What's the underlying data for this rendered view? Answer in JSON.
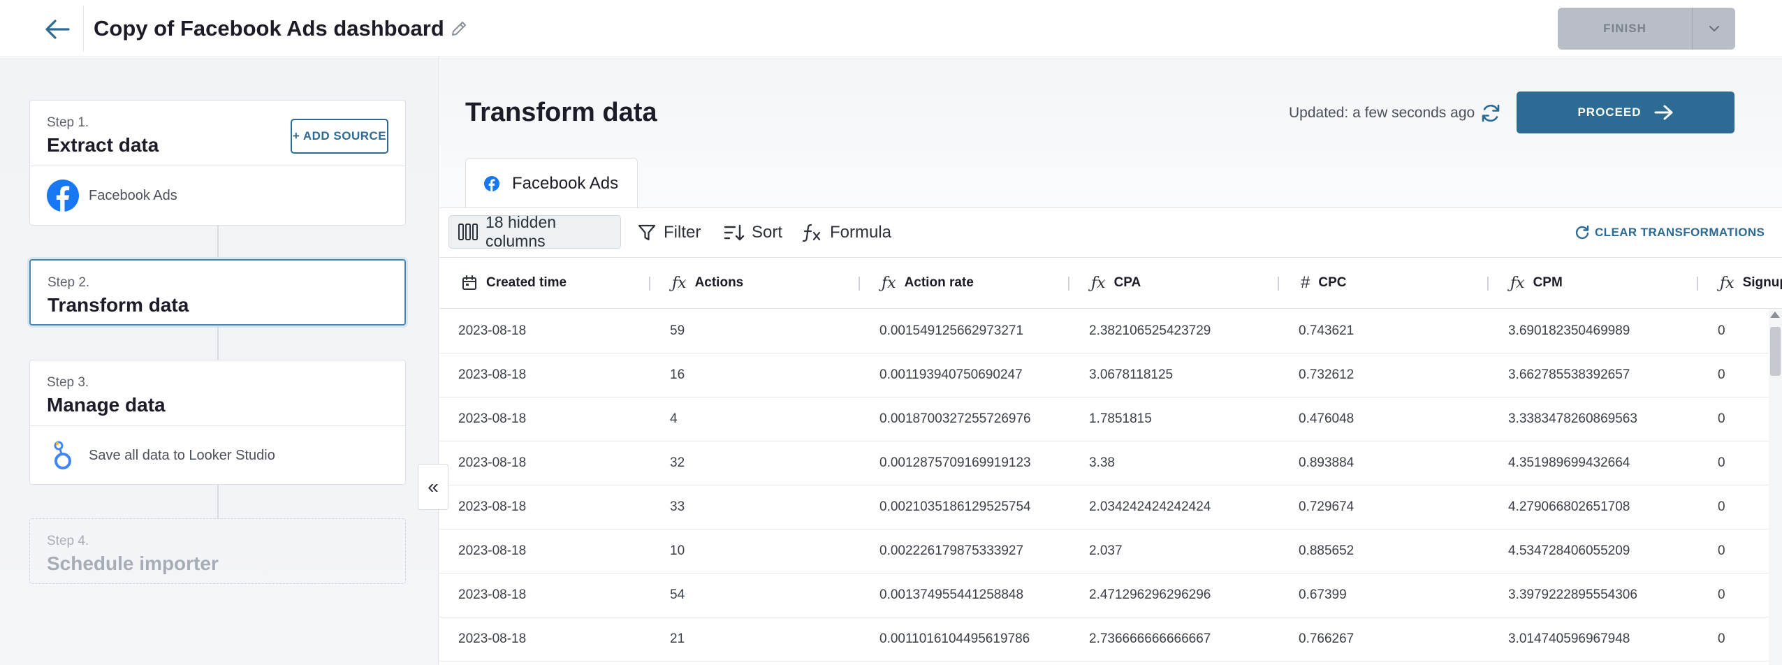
{
  "header": {
    "title": "Copy of Facebook Ads dashboard",
    "finish_label": "FINISH"
  },
  "steps": [
    {
      "num": "Step 1.",
      "title": "Extract data",
      "action": "+ ADD SOURCE",
      "sub": "Facebook Ads",
      "sub_icon": "facebook-icon"
    },
    {
      "num": "Step 2.",
      "title": "Transform data"
    },
    {
      "num": "Step 3.",
      "title": "Manage data",
      "sub": "Save all data to Looker Studio",
      "sub_icon": "looker-studio-icon"
    },
    {
      "num": "Step 4.",
      "title": "Schedule importer"
    }
  ],
  "sidebar": {
    "collapse_label": "«"
  },
  "main": {
    "title": "Transform data",
    "updated": "Updated: a few seconds ago",
    "proceed_label": "PROCEED",
    "tab_label": "Facebook Ads"
  },
  "toolbar": {
    "hidden_columns": "18 hidden columns",
    "filter": "Filter",
    "sort": "Sort",
    "formula": "Formula",
    "clear": "CLEAR TRANSFORMATIONS"
  },
  "table": {
    "columns": [
      {
        "label": "Created time",
        "type_icon": "calendar-icon"
      },
      {
        "label": "Actions",
        "type_icon": "formula-icon"
      },
      {
        "label": "Action rate",
        "type_icon": "formula-icon"
      },
      {
        "label": "CPA",
        "type_icon": "formula-icon"
      },
      {
        "label": "CPC",
        "type_icon": "number-icon"
      },
      {
        "label": "CPM",
        "type_icon": "formula-icon"
      },
      {
        "label": "Signup",
        "type_icon": "formula-icon"
      }
    ],
    "rows": [
      [
        "2023-08-18",
        "59",
        "0.001549125662973271",
        "2.382106525423729",
        "0.743621",
        "3.690182350469989",
        "0"
      ],
      [
        "2023-08-18",
        "16",
        "0.001193940750690247",
        "3.0678118125",
        "0.732612",
        "3.662785538392657",
        "0"
      ],
      [
        "2023-08-18",
        "4",
        "0.0018700327255726976",
        "1.7851815",
        "0.476048",
        "3.3383478260869563",
        "0"
      ],
      [
        "2023-08-18",
        "32",
        "0.0012875709169919123",
        "3.38",
        "0.893884",
        "4.351989699432664",
        "0"
      ],
      [
        "2023-08-18",
        "33",
        "0.0021035186129525754",
        "2.034242424242424",
        "0.729674",
        "4.279066802651708",
        "0"
      ],
      [
        "2023-08-18",
        "10",
        "0.002226179875333927",
        "2.037",
        "0.885652",
        "4.534728406055209",
        "0"
      ],
      [
        "2023-08-18",
        "54",
        "0.001374955441258848",
        "2.471296296296296",
        "0.67399",
        "3.3979222895554306",
        "0"
      ],
      [
        "2023-08-18",
        "21",
        "0.0011016104495619786",
        "2.736666666666667",
        "0.766267",
        "3.014740596967948",
        "0"
      ]
    ]
  },
  "colors": {
    "accent": "#2c6b93",
    "facebook": "#1877f2",
    "disabled": "#b9bec6"
  }
}
